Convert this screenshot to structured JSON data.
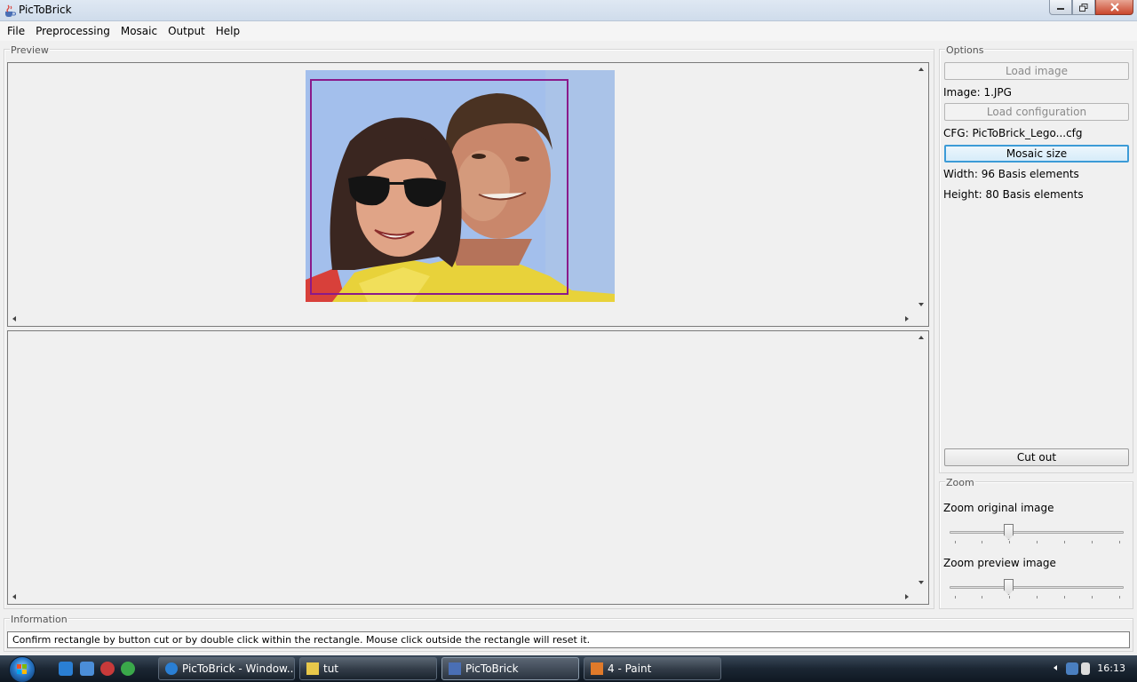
{
  "window": {
    "title": "PicToBrick"
  },
  "menu": [
    "File",
    "Preprocessing",
    "Mosaic",
    "Output",
    "Help"
  ],
  "preview": {
    "title": "Preview"
  },
  "options": {
    "title": "Options",
    "load_image": "Load image",
    "image_label": "Image: 1.JPG",
    "load_configuration": "Load configuration",
    "cfg_label": "CFG: PicToBrick_Lego...cfg",
    "mosaic_size": "Mosaic size",
    "width_label": "Width: 96 Basis elements",
    "height_label": "Height: 80 Basis elements",
    "cut_out": "Cut out"
  },
  "zoom": {
    "title": "Zoom",
    "original_label": "Zoom original image",
    "original_value": 0.33,
    "preview_label": "Zoom preview image",
    "preview_value": 0.33
  },
  "information": {
    "title": "Information",
    "message": "Confirm rectangle by button cut or by double click within the rectangle. Mouse click outside the rectangle will reset it."
  },
  "taskbar": {
    "tasks": [
      "PicToBrick - Window...",
      "tut",
      "PicToBrick",
      "4 - Paint"
    ],
    "active_task": "PicToBrick",
    "time": "16:13"
  },
  "colors": {
    "selection": "#8a1a8a",
    "focus": "#3c9bd7",
    "sky": "#9fbcec",
    "shirt": "#e8d23a"
  }
}
